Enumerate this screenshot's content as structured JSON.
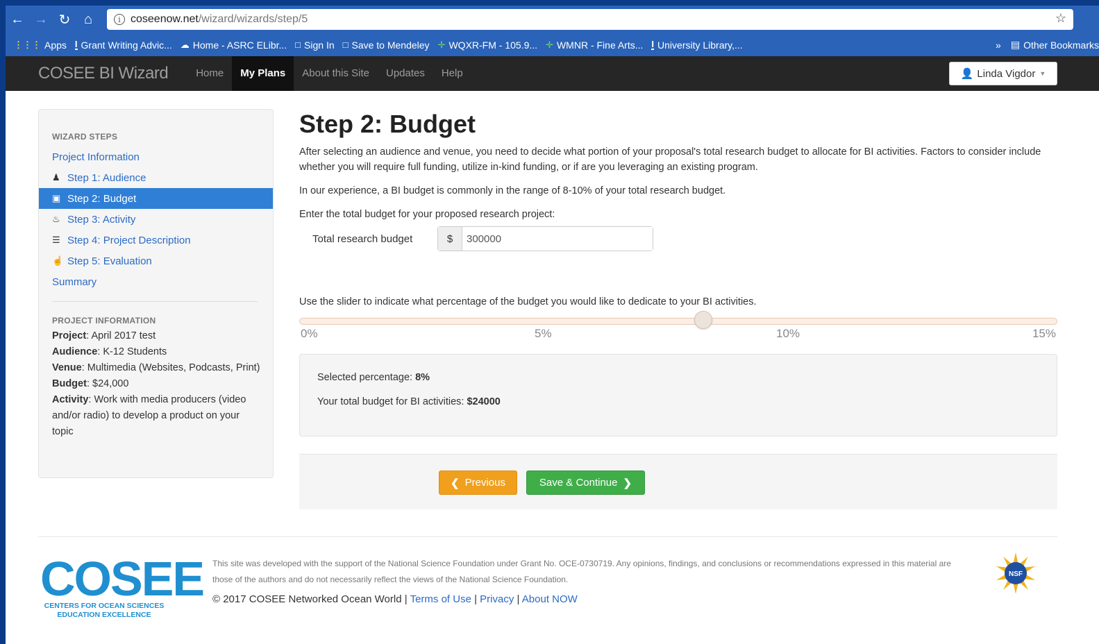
{
  "browser": {
    "url_host": "coseenow.net",
    "url_path": "/wizard/wizards/step/5",
    "bookmarks": [
      {
        "label": "Apps",
        "icon": "apps-grid-icon"
      },
      {
        "label": "Grant Writing Advic...",
        "icon": "bookmark-page-icon"
      },
      {
        "label": "Home - ASRC ELibr...",
        "icon": "cloud-icon"
      },
      {
        "label": "Sign In",
        "icon": "page-icon"
      },
      {
        "label": "Save to Mendeley",
        "icon": "page-icon"
      },
      {
        "label": "WQXR-FM - 105.9...",
        "icon": "radio-icon"
      },
      {
        "label": "WMNR - Fine Arts...",
        "icon": "radio-icon"
      },
      {
        "label": "University Library,...",
        "icon": "illinois-icon"
      }
    ],
    "other_bookmarks": "Other Bookmarks",
    "overflow_chevron": "»"
  },
  "navbar": {
    "brand": "COSEE BI Wizard",
    "links": [
      "Home",
      "My Plans",
      "About this Site",
      "Updates",
      "Help"
    ],
    "active_link": "My Plans",
    "user": "Linda Vigdor"
  },
  "sidebar": {
    "steps_heading": "WIZARD STEPS",
    "items": [
      {
        "label": "Project Information",
        "icon": ""
      },
      {
        "label": "Step 1: Audience",
        "icon": "user-icon"
      },
      {
        "label": "Step 2: Budget",
        "icon": "briefcase-icon"
      },
      {
        "label": "Step 3: Activity",
        "icon": "fire-icon"
      },
      {
        "label": "Step 4: Project Description",
        "icon": "list-icon"
      },
      {
        "label": "Step 5: Evaluation",
        "icon": "thumbs-up-icon"
      },
      {
        "label": "Summary",
        "icon": ""
      }
    ],
    "active_item": "Step 2: Budget",
    "info_heading": "PROJECT INFORMATION",
    "info": {
      "project_label": "Project",
      "project": "April 2017 test",
      "audience_label": "Audience",
      "audience": "K-12 Students",
      "venue_label": "Venue",
      "venue": "Multimedia (Websites, Podcasts, Print)",
      "budget_label": "Budget",
      "budget": "$24,000",
      "activity_label": "Activity",
      "activity": "Work with media producers (video and/or radio) to develop a product on your topic"
    }
  },
  "main": {
    "title": "Step 2: Budget",
    "intro": "After selecting an audience and venue, you need to decide what portion of your proposal's total research budget to allocate for BI activities. Factors to consider include whether you will require full funding, utilize in-kind funding, or if are you leveraging an existing program.",
    "experience": "In our experience, a BI budget is commonly in the range of 8-10% of your total research budget.",
    "enter_prompt": "Enter the total budget for your proposed research project:",
    "budget_label": "Total research budget",
    "currency": "$",
    "budget_value": "300000",
    "slider_prompt": "Use the slider to indicate what percentage of the budget you would like to dedicate to your BI activities.",
    "slider": {
      "min": 0,
      "max": 15,
      "value": 8,
      "ticks": [
        "0%",
        "5%",
        "10%",
        "15%"
      ]
    },
    "selected_label": "Selected percentage:",
    "selected_value": "8%",
    "total_label": "Your total budget for BI activities:",
    "total_value": "$24000",
    "prev_button": "Previous",
    "next_button": "Save & Continue"
  },
  "footer": {
    "logo_word": "COSEE",
    "logo_sub": "CENTERS FOR OCEAN SCIENCES EDUCATION EXCELLENCE",
    "disclaimer": "This site was developed with the support of the National Science Foundation under Grant No. OCE-0730719. Any opinions, findings, and conclusions or recommendations expressed in this material are those of the authors and do not necessarily reflect the views of the National Science Foundation.",
    "copyright": "© 2017 COSEE Networked Ocean World",
    "links": [
      "Terms of Use",
      "Privacy",
      "About NOW"
    ],
    "separator": "|",
    "nsf_logo_text": "NSF"
  },
  "colors": {
    "desktop": "#0b3b86",
    "browser_chrome": "#2a63b8",
    "navbar": "#262626",
    "link": "#2a6bc5",
    "active_step": "#2f7fd6",
    "prev_button": "#f0a01c",
    "next_button": "#3fae49"
  }
}
